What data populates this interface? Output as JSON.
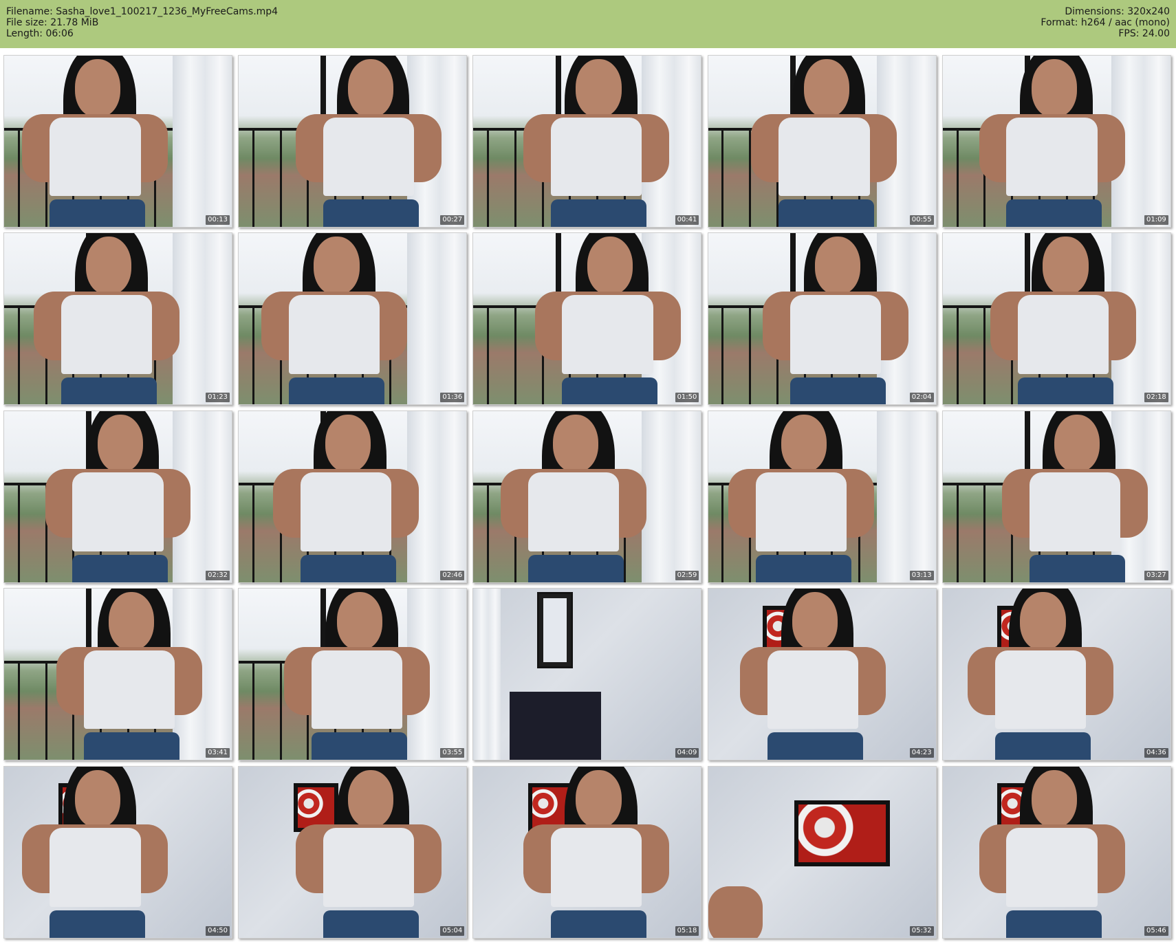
{
  "header": {
    "background_color": "#adc97e",
    "filename_label": "Filename: Sasha_love1_100217_1236_MyFreeCams.mp4",
    "filesize_label": "File size: 21.78 MiB",
    "length_label": "Length: 06:06",
    "dimensions_label": "Dimensions: 320x240",
    "format_label": "Format: h264 / aac (mono)",
    "fps_label": "FPS: 24.00"
  },
  "thumbnails": [
    {
      "timestamp": "00:13",
      "scene": "balcony"
    },
    {
      "timestamp": "00:27",
      "scene": "balcony"
    },
    {
      "timestamp": "00:41",
      "scene": "balcony"
    },
    {
      "timestamp": "00:55",
      "scene": "balcony"
    },
    {
      "timestamp": "01:09",
      "scene": "balcony"
    },
    {
      "timestamp": "01:23",
      "scene": "balcony"
    },
    {
      "timestamp": "01:36",
      "scene": "balcony"
    },
    {
      "timestamp": "01:50",
      "scene": "balcony"
    },
    {
      "timestamp": "02:04",
      "scene": "balcony"
    },
    {
      "timestamp": "02:18",
      "scene": "balcony"
    },
    {
      "timestamp": "02:32",
      "scene": "balcony"
    },
    {
      "timestamp": "02:46",
      "scene": "balcony"
    },
    {
      "timestamp": "02:59",
      "scene": "balcony"
    },
    {
      "timestamp": "03:13",
      "scene": "balcony"
    },
    {
      "timestamp": "03:27",
      "scene": "balcony"
    },
    {
      "timestamp": "03:41",
      "scene": "balcony"
    },
    {
      "timestamp": "03:55",
      "scene": "balcony"
    },
    {
      "timestamp": "04:09",
      "scene": "room-dresser"
    },
    {
      "timestamp": "04:23",
      "scene": "room"
    },
    {
      "timestamp": "04:36",
      "scene": "room"
    },
    {
      "timestamp": "04:50",
      "scene": "room"
    },
    {
      "timestamp": "05:04",
      "scene": "room"
    },
    {
      "timestamp": "05:18",
      "scene": "room"
    },
    {
      "timestamp": "05:32",
      "scene": "room-painting"
    },
    {
      "timestamp": "05:46",
      "scene": "room"
    }
  ]
}
